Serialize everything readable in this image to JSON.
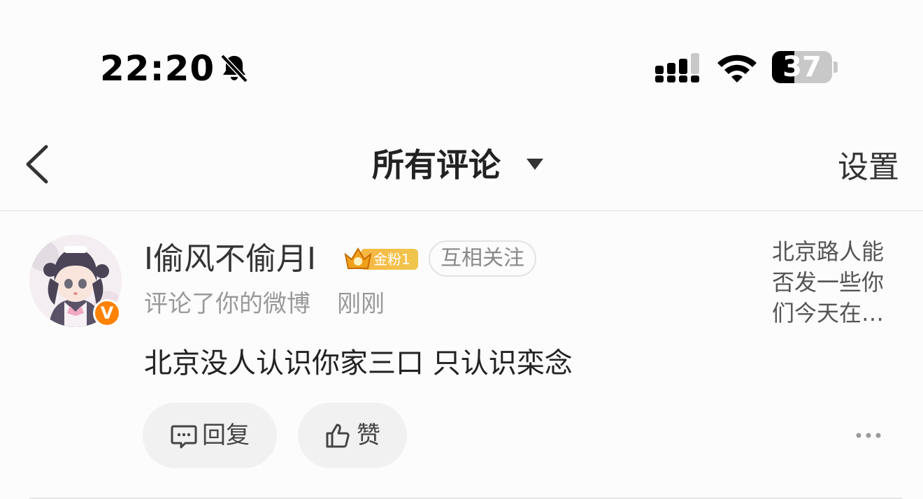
{
  "status_bar": {
    "time": "22:20",
    "battery": "37",
    "battery_level_percent": 37,
    "icons": [
      "bell-slash-icon",
      "cellular-signal-icon",
      "wifi-icon",
      "battery-icon"
    ]
  },
  "nav": {
    "title": "所有评论",
    "settings_label": "设置",
    "icons": [
      "back-chevron-icon",
      "caret-down-icon"
    ]
  },
  "comment": {
    "username": "I偷风不偷月I",
    "fan_badge": "金粉1",
    "mutual_follow": "互相关注",
    "action": "评论了你的微博",
    "time": "刚刚",
    "text": "北京没人认识你家三口 只认识栾念",
    "reply_label": "回复",
    "like_label": "赞",
    "post_preview": [
      "北京路人能",
      "否发一些你",
      "们今天在…"
    ]
  },
  "colors": {
    "verified_badge": "#ff8200",
    "fan_badge": "#f2b84a",
    "background": "#fcfcfc"
  }
}
